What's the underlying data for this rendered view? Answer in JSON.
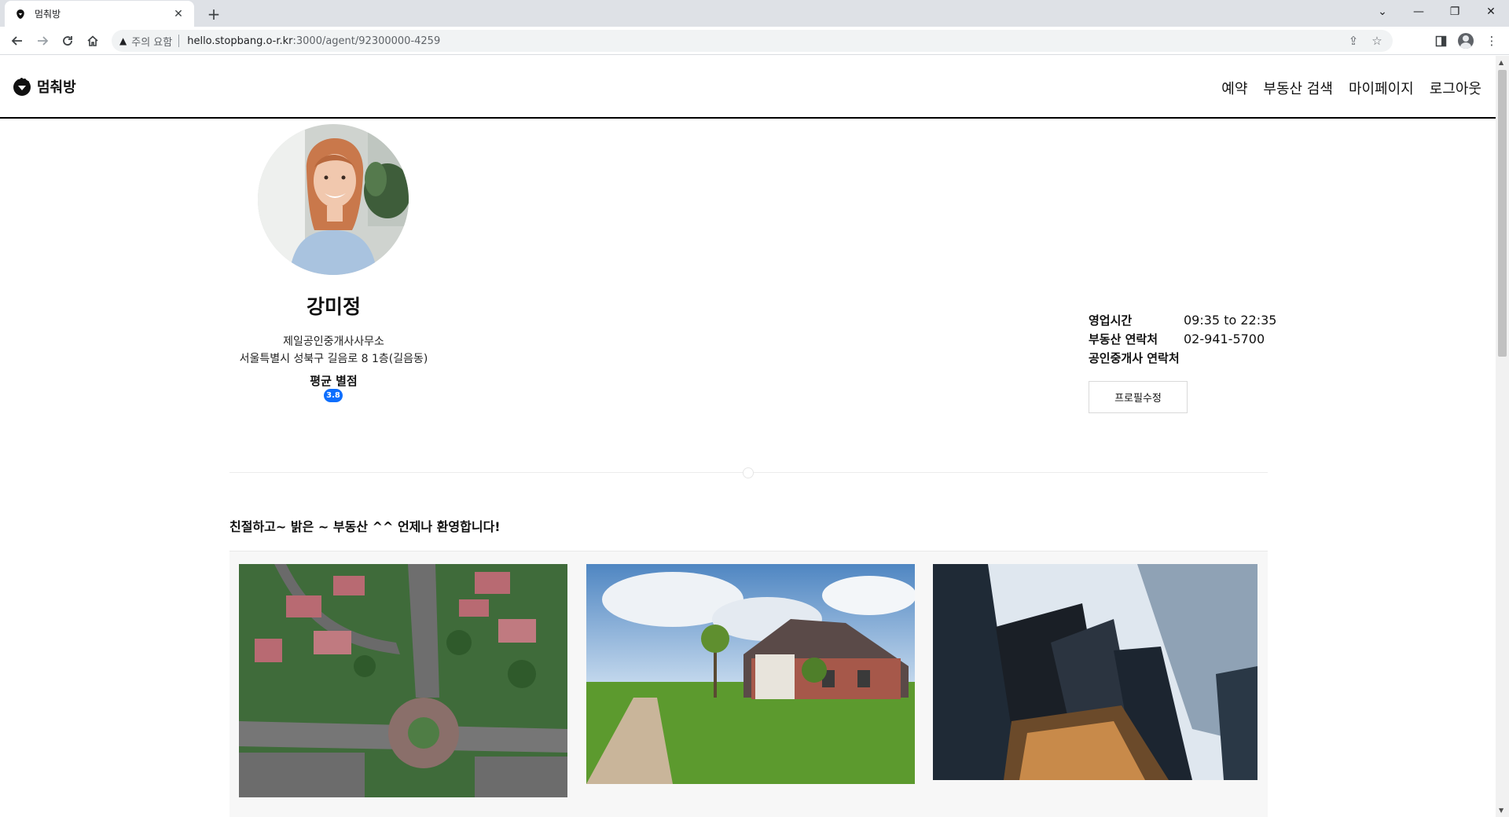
{
  "browser": {
    "tab_title": "멈춰방",
    "new_tab": "+",
    "url_warning": "주의 요함",
    "url_host": "hello.stopbang.o-r.kr",
    "url_path": ":3000/agent/92300000-4259",
    "icons": [
      "back-icon",
      "forward-icon",
      "reload-icon",
      "home-icon",
      "warning-icon",
      "share-icon",
      "star-icon",
      "sidepanel-icon",
      "profile-icon",
      "menu-icon"
    ]
  },
  "site": {
    "logo_text": "멈춰방",
    "nav": [
      "예약",
      "부동산 검색",
      "마이페이지",
      "로그아웃"
    ]
  },
  "agent": {
    "name": "강미정",
    "office_name": "제일공인중개사사무소",
    "address": "서울특별시 성북구 길음로 8 1층(길음동)",
    "rating_label": "평균 별점",
    "rating": "3.8",
    "info": [
      {
        "key": "영업시간",
        "value": "09:35 to 22:35"
      },
      {
        "key": "부동산 연락처",
        "value": "02-941-5700"
      },
      {
        "key": "공인중개사 연락처",
        "value": ""
      }
    ],
    "edit_button": "프로필수정",
    "intro": "친절하고~ 밝은 ~ 부동산 ^^ 언제나 환영합니다!"
  },
  "colors": {
    "accent": "#0d6efd",
    "header_border": "#000000"
  }
}
